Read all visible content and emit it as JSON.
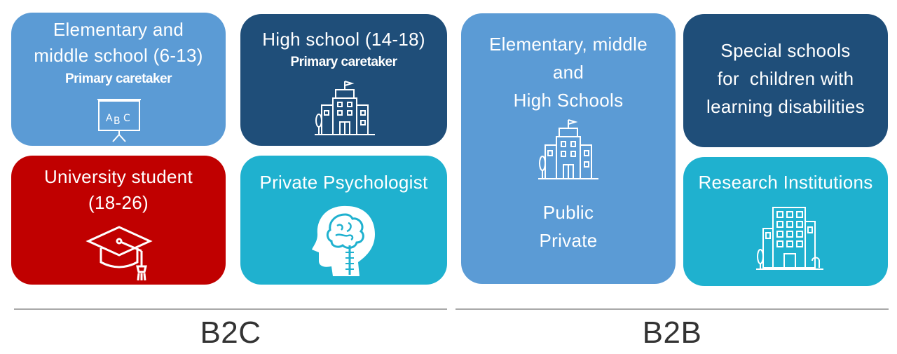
{
  "colors": {
    "light_blue": "#5b9bd5",
    "navy": "#1f4e79",
    "red": "#c00000",
    "teal": "#1fb1cf",
    "divider": "#a8a8a8",
    "label_text": "#333333"
  },
  "b2c": {
    "label": "B2C",
    "tiles": {
      "elementary": {
        "title_line1": "Elementary and",
        "title_line2": "middle school (6-13)",
        "subtitle": "Primary caretaker",
        "icon": "abc-board-icon"
      },
      "high_school": {
        "title": "High school (14-18)",
        "subtitle": "Primary caretaker",
        "icon": "school-building-icon"
      },
      "university": {
        "title_line1": "University student",
        "title_line2": "(18-26)",
        "icon": "graduation-cap-icon"
      },
      "psychologist": {
        "title": "Private Psychologist",
        "icon": "brain-head-icon"
      }
    }
  },
  "b2b": {
    "label": "B2B",
    "tiles": {
      "schools": {
        "title_line1": "Elementary, middle",
        "title_line2": "and",
        "title_line3": "High Schools",
        "line_public": "Public",
        "line_private": "Private",
        "icon": "school-building-icon"
      },
      "special": {
        "title_line1": "Special schools",
        "title_line2": "for  children with",
        "title_line3": "learning disabilities"
      },
      "research": {
        "title": "Research Institutions",
        "icon": "office-building-icon"
      }
    }
  }
}
